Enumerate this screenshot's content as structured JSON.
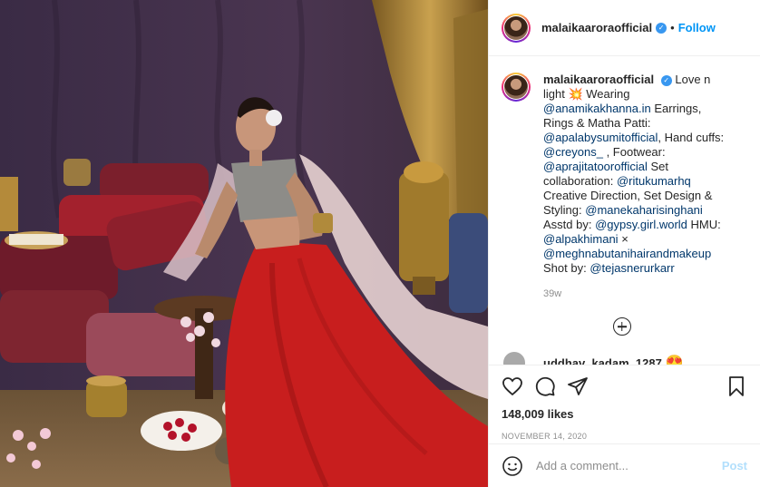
{
  "photo": {
    "description_icon": "fashion-photo"
  },
  "header": {
    "username": "malaikaaroraofficial",
    "separator": "•",
    "follow_label": "Follow",
    "verified_glyph": "✓"
  },
  "caption": {
    "username": "malaikaaroraofficial",
    "verified_glyph": "✓",
    "parts": [
      {
        "t": "text",
        "v": "Love n light "
      },
      {
        "t": "text",
        "v": "💥 Wearing "
      },
      {
        "t": "mention",
        "v": "@anamikakhanna.in"
      },
      {
        "t": "text",
        "v": " Earrings, Rings & Matha Patti: "
      },
      {
        "t": "mention",
        "v": "@apalabysumitofficial"
      },
      {
        "t": "text",
        "v": ", Hand cuffs: "
      },
      {
        "t": "mention",
        "v": "@creyons_"
      },
      {
        "t": "text",
        "v": " , Footwear: "
      },
      {
        "t": "mention",
        "v": "@aprajitatoorofficial"
      },
      {
        "t": "text",
        "v": " Set collaboration: "
      },
      {
        "t": "mention",
        "v": "@ritukumarhq"
      },
      {
        "t": "text",
        "v": " Creative Direction, Set Design & Styling: "
      },
      {
        "t": "mention",
        "v": "@manekaharisinghani"
      },
      {
        "t": "text",
        "v": " Asstd by: "
      },
      {
        "t": "mention",
        "v": "@gypsy.girl.world"
      },
      {
        "t": "text",
        "v": " HMU: "
      },
      {
        "t": "mention",
        "v": "@alpakhimani"
      },
      {
        "t": "text",
        "v": " × "
      },
      {
        "t": "mention",
        "v": "@meghnabutanihairandmakeup"
      },
      {
        "t": "text",
        "v": " Shot by: "
      },
      {
        "t": "mention",
        "v": "@tejasnerurkarr"
      }
    ],
    "age": "39w"
  },
  "next_comment": {
    "username": "uddhav_kadam_1287",
    "emoji": "😍"
  },
  "actions": {
    "likes": "148,009 likes",
    "date": "NOVEMBER 14, 2020"
  },
  "add_comment": {
    "placeholder": "Add a comment...",
    "post_label": "Post"
  }
}
